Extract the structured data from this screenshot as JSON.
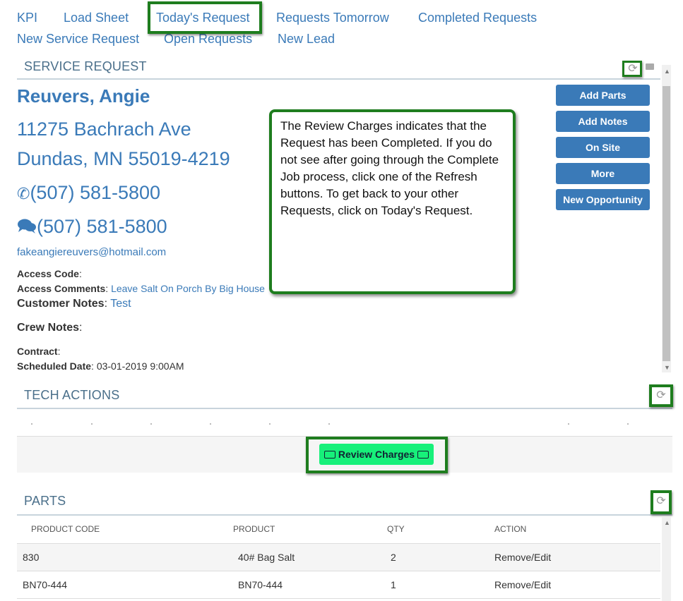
{
  "nav": {
    "kpi": "KPI",
    "load_sheet": "Load Sheet",
    "todays_request": "Today's Request",
    "requests_tomorrow": "Requests Tomorrow",
    "completed_requests": "Completed Requests",
    "new_service_request": "New Service Request",
    "open_requests": "Open Requests",
    "new_lead": "New Lead"
  },
  "service_request": {
    "section_title": "SERVICE REQUEST",
    "customer_name": "Reuvers, Angie",
    "address_line1": "11275 Bachrach Ave",
    "address_line2": "Dundas, MN 55019-4219",
    "phone": "(507) 581-5800",
    "text_phone": "(507) 581-5800",
    "email": "fakeangiereuvers@hotmail.com",
    "access_code_label": "Access Code",
    "access_code_value": "",
    "access_comments_label": "Access Comments",
    "access_comments_value": "Leave Salt On Porch By Big House",
    "customer_notes_label": "Customer Notes",
    "customer_notes_value": "Test",
    "crew_notes_label": "Crew Notes",
    "contract_label": "Contract",
    "scheduled_date_label": "Scheduled Date",
    "scheduled_date_value": "03-01-2019 9:00AM"
  },
  "actions": {
    "add_parts": "Add Parts",
    "add_notes": "Add Notes",
    "on_site": "On Site",
    "more": "More",
    "new_opportunity": "New Opportunity"
  },
  "callout": {
    "text": "The Review Charges indicates that the Request has been Completed. If you do not see after going through the Complete Job process, click one of the Refresh buttons. To get back to your other Requests, click on Today's Request."
  },
  "tech_actions": {
    "section_title": "TECH ACTIONS",
    "review_charges": "Review Charges"
  },
  "parts": {
    "section_title": "PARTS",
    "columns": [
      "PRODUCT CODE",
      "PRODUCT",
      "QTY",
      "ACTION"
    ],
    "rows": [
      {
        "code": "830",
        "product": "40# Bag Salt",
        "qty": "2",
        "action": "Remove/Edit"
      },
      {
        "code": "BN70-444",
        "product": "BN70-444",
        "qty": "1",
        "action": "Remove/Edit"
      }
    ]
  },
  "colors": {
    "link_blue": "#3a7ab8",
    "highlight_green": "#1e7d1e",
    "review_green": "#17f07a"
  }
}
